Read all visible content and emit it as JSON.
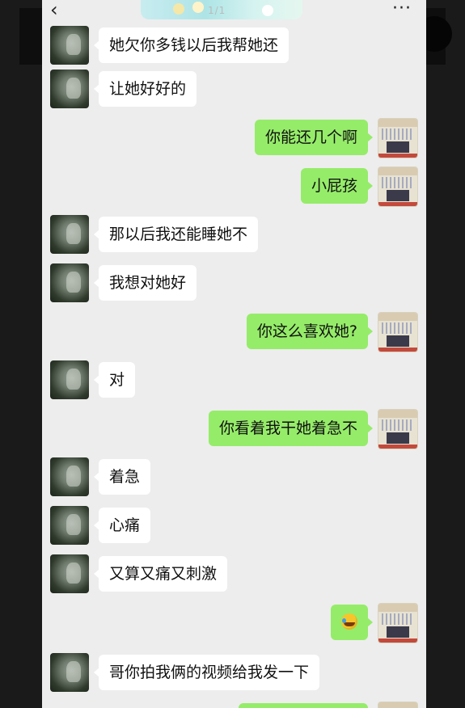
{
  "topbar": {
    "back_icon": "‹",
    "more_icon": "···",
    "banner_text": "1/1"
  },
  "messages": [
    {
      "side": "left",
      "text": "她欠你多钱以后我帮她还"
    },
    {
      "side": "left",
      "text": "让她好好的"
    },
    {
      "side": "right",
      "text": "你能还几个啊"
    },
    {
      "side": "right",
      "text": "小屁孩"
    },
    {
      "side": "left",
      "text": "那以后我还能睡她不"
    },
    {
      "side": "left",
      "text": "我想对她好"
    },
    {
      "side": "right",
      "text": "你这么喜欢她?"
    },
    {
      "side": "left",
      "text": "对"
    },
    {
      "side": "right",
      "text": "你看着我干她着急不"
    },
    {
      "side": "left",
      "text": "着急"
    },
    {
      "side": "left",
      "text": "心痛"
    },
    {
      "side": "left",
      "text": "又算又痛又刺激"
    },
    {
      "side": "right",
      "text": "",
      "emoji": "laughing-tears-emoji"
    },
    {
      "side": "left",
      "text": "哥你拍我俩的视频给我发一下"
    },
    {
      "side": "right",
      "text": ""
    }
  ]
}
